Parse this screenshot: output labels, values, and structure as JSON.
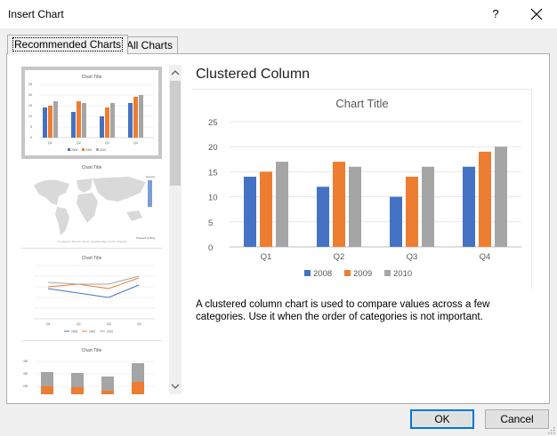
{
  "dialog": {
    "title": "Insert Chart",
    "help_label": "?",
    "tabs": [
      {
        "label": "Recommended Charts",
        "selected": true
      },
      {
        "label": "All Charts",
        "selected": false
      }
    ],
    "buttons": {
      "ok": "OK",
      "cancel": "Cancel"
    }
  },
  "thumbnails": [
    {
      "name": "Clustered Column",
      "title": "Chart Title",
      "selected": true
    },
    {
      "name": "Filled Map",
      "title": "Chart Title",
      "selected": false
    },
    {
      "name": "Line",
      "title": "Chart Title",
      "selected": false
    },
    {
      "name": "Stacked Column",
      "title": "Chart Title",
      "selected": false
    }
  ],
  "preview": {
    "heading": "Clustered Column",
    "description": "A clustered column chart is used to compare values across a few categories. Use it when the order of categories is not important."
  },
  "chart_data": {
    "type": "bar",
    "title": "Chart Title",
    "categories": [
      "Q1",
      "Q2",
      "Q3",
      "Q4"
    ],
    "series": [
      {
        "name": "2008",
        "color": "#4472c4",
        "values": [
          14,
          12,
          10,
          16
        ]
      },
      {
        "name": "2009",
        "color": "#ed7d31",
        "values": [
          15,
          17,
          14,
          19
        ]
      },
      {
        "name": "2010",
        "color": "#a5a5a5",
        "values": [
          17,
          16,
          16,
          20
        ]
      }
    ],
    "ylim": [
      0,
      25
    ],
    "yticks": [
      "0",
      "5",
      "10",
      "15",
      "20",
      "25"
    ],
    "grid": true,
    "legend": "bottom"
  },
  "colors": {
    "accent": "#0078d7",
    "selected_thumb_border": "#c6c6c6"
  }
}
